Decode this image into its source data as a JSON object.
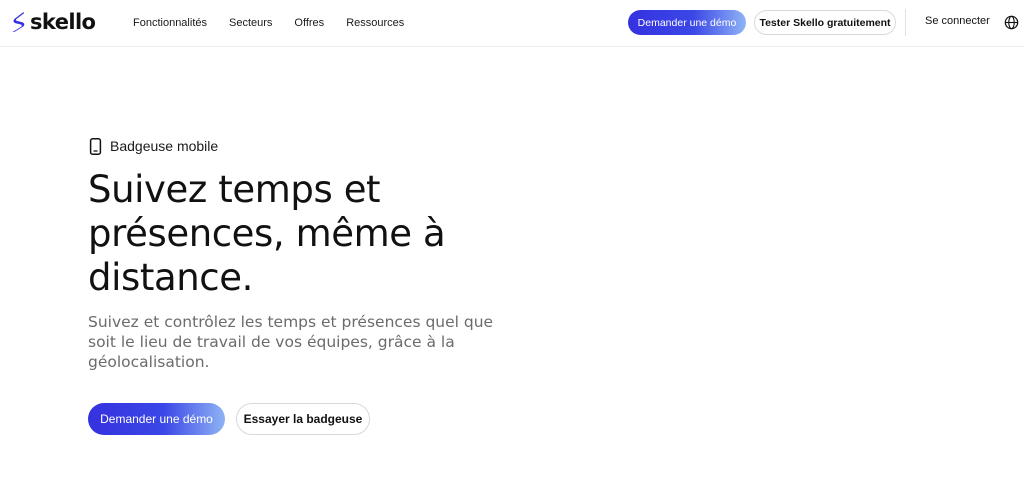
{
  "brand": {
    "name": "skello",
    "accent_color": "#3531e0",
    "gradient_end_color": "#8fb3f5"
  },
  "nav": {
    "items": [
      {
        "label": "Fonctionnalités"
      },
      {
        "label": "Secteurs"
      },
      {
        "label": "Offres"
      },
      {
        "label": "Ressources"
      }
    ]
  },
  "header_actions": {
    "demo_label": "Demander une démo",
    "try_label": "Tester Skello gratuitement",
    "login_label": "Se connecter",
    "language_icon": "globe-icon"
  },
  "hero": {
    "eyebrow_icon": "smartphone-icon",
    "eyebrow": "Badgeuse mobile",
    "title": "Suivez temps et présences, même à distance.",
    "subtitle": "Suivez et contrôlez les temps et présences quel que soit le lieu de travail de vos équipes, grâce à la géolocalisation.",
    "primary_cta": "Demander une démo",
    "secondary_cta": "Essayer la badgeuse"
  }
}
